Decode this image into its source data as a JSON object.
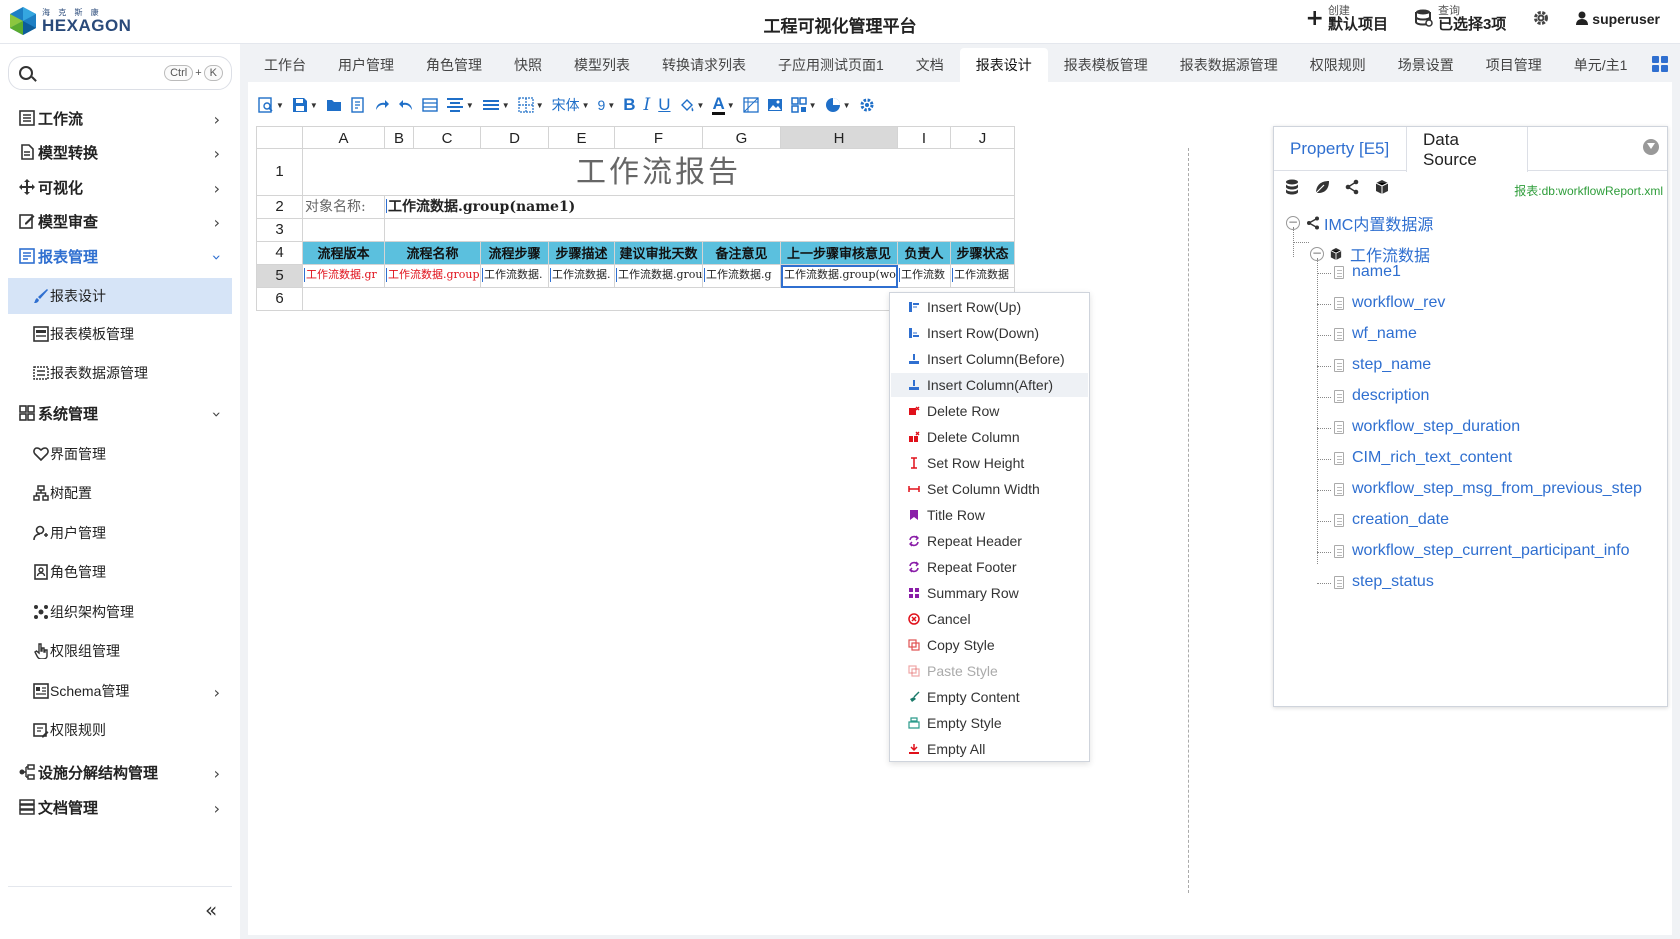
{
  "app": {
    "logo_sub": "海 克 斯 康",
    "logo_main": "HEXAGON",
    "title": "工程可视化管理平台",
    "create_small": "创建",
    "create_big": "默认项目",
    "query_small": "查询",
    "query_big": "已选择3项",
    "user": "superuser"
  },
  "search": {
    "placeholder": "",
    "kbd1": "Ctrl",
    "kbd_plus": "+",
    "kbd2": "K"
  },
  "sidebar": {
    "items": [
      {
        "label": "工作流"
      },
      {
        "label": "模型转换"
      },
      {
        "label": "可视化"
      },
      {
        "label": "模型审查"
      },
      {
        "label": "报表管理"
      },
      {
        "label": "报表设计"
      },
      {
        "label": "报表模板管理"
      },
      {
        "label": "报表数据源管理"
      },
      {
        "label": "系统管理"
      },
      {
        "label": "界面管理"
      },
      {
        "label": "树配置"
      },
      {
        "label": "用户管理"
      },
      {
        "label": "角色管理"
      },
      {
        "label": "组织架构管理"
      },
      {
        "label": "权限组管理"
      },
      {
        "label": "Schema管理"
      },
      {
        "label": "权限规则"
      },
      {
        "label": "设施分解结构管理"
      },
      {
        "label": "文档管理"
      }
    ],
    "collapse": "«"
  },
  "tabs": [
    "工作台",
    "用户管理",
    "角色管理",
    "快照",
    "模型列表",
    "转换请求列表",
    "子应用测试页面1",
    "文档",
    "报表设计",
    "报表模板管理",
    "报表数据源管理",
    "权限规则",
    "场景设置",
    "项目管理",
    "单元/主1"
  ],
  "toolbar": {
    "font": "宋体",
    "size": "9",
    "bold": "B",
    "italic": "I",
    "underline": "U",
    "fontcolor": "A"
  },
  "sheet": {
    "columns": [
      "A",
      "B",
      "C",
      "D",
      "E",
      "F",
      "G",
      "H",
      "I",
      "J"
    ],
    "rows": [
      "1",
      "2",
      "3",
      "4",
      "5",
      "6"
    ],
    "title": "工作流报告",
    "object_label": "对象名称:",
    "object_value": "工作流数据.group(name1)",
    "headers": [
      "流程版本",
      "流程名称",
      "流程步骤",
      "步骤描述",
      "建议审批天数",
      "备注意见",
      "上一步骤审核意见",
      "负责人",
      "步骤状态"
    ],
    "data_row": [
      "工作流数据.gr",
      "工作流数据.group",
      "工作流数据.",
      "工作流数据.",
      "工作流数据.grou",
      "工作流数据.g",
      "工作流数据.group(wo",
      "工作流数",
      "工作流数据"
    ]
  },
  "context_menu": [
    {
      "label": "Insert Row(Up)",
      "icon": "insert-row-up-icon",
      "color": "#2f6fd0"
    },
    {
      "label": "Insert Row(Down)",
      "icon": "insert-row-down-icon",
      "color": "#2f6fd0"
    },
    {
      "label": "Insert Column(Before)",
      "icon": "insert-col-before-icon",
      "color": "#2f6fd0"
    },
    {
      "label": "Insert Column(After)",
      "icon": "insert-col-after-icon",
      "color": "#2f6fd0"
    },
    {
      "label": "Delete Row",
      "icon": "delete-row-icon",
      "color": "#e0101a"
    },
    {
      "label": "Delete Column",
      "icon": "delete-column-icon",
      "color": "#e0101a"
    },
    {
      "label": "Set Row Height",
      "icon": "row-height-icon",
      "color": "#e0101a"
    },
    {
      "label": "Set Column Width",
      "icon": "column-width-icon",
      "color": "#e0101a"
    },
    {
      "label": "Title Row",
      "icon": "bookmark-icon",
      "color": "#8a1ea8"
    },
    {
      "label": "Repeat Header",
      "icon": "repeat-header-icon",
      "color": "#8a1ea8"
    },
    {
      "label": "Repeat Footer",
      "icon": "repeat-footer-icon",
      "color": "#8a1ea8"
    },
    {
      "label": "Summary Row",
      "icon": "summary-grid-icon",
      "color": "#8a1ea8"
    },
    {
      "label": "Cancel",
      "icon": "cancel-icon",
      "color": "#e0101a"
    },
    {
      "label": "Copy Style",
      "icon": "copy-style-icon",
      "color": "#e05050"
    },
    {
      "label": "Paste Style",
      "icon": "paste-style-icon",
      "color": "#e05050"
    },
    {
      "label": "Empty Content",
      "icon": "broom-icon",
      "color": "#1a7a6a"
    },
    {
      "label": "Empty Style",
      "icon": "empty-style-icon",
      "color": "#2a9a8a"
    },
    {
      "label": "Empty All",
      "icon": "empty-all-icon",
      "color": "#e0101a"
    }
  ],
  "right_panel": {
    "tab_property": "Property [E5]",
    "tab_datasource": "Data Source",
    "path": "报表:db:workflowReport.xml",
    "root": "IMC内置数据源",
    "dataset": "工作流数据",
    "fields": [
      "name1",
      "workflow_rev",
      "wf_name",
      "step_name",
      "description",
      "workflow_step_duration",
      "CIM_rich_text_content",
      "workflow_step_msg_from_previous_step",
      "creation_date",
      "workflow_step_current_participant_info",
      "step_status"
    ]
  },
  "colors": {
    "accent": "#2f6fd0",
    "header_cell": "#5bc0de",
    "active_menu": "#d6e4f7"
  }
}
